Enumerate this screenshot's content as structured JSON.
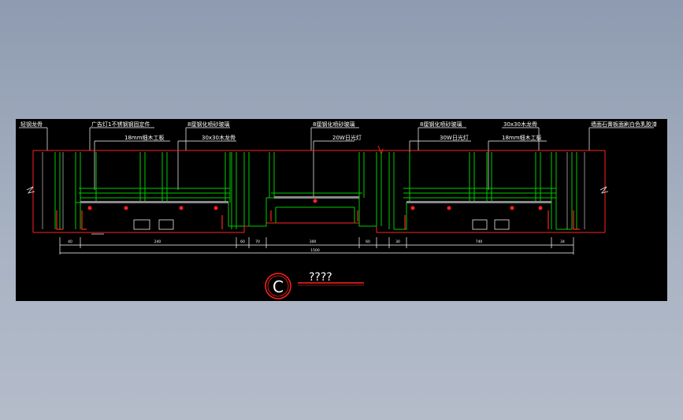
{
  "drawing": {
    "title_symbol": "C",
    "title_text": "????",
    "top_labels": [
      "轻钢龙骨",
      "广告灯1不锈钢钢固定件",
      "8厘钢化喷砂玻璃",
      "8厘钢化喷砂玻璃",
      "8厘钢化喷砂玻璃",
      "30x30木龙骨",
      "墙面石膏板面刷白色乳胶漆"
    ],
    "second_labels": [
      "18mm细木工板",
      "30x30木龙骨",
      "20W日光灯",
      "30W日光灯",
      "18mm细木工板"
    ],
    "dims": [
      "40",
      "240",
      "60",
      "70",
      "300",
      "60",
      "30",
      "740",
      "34"
    ],
    "total_dim": "1500"
  },
  "colors": {
    "line_green": "#00cc00",
    "line_red": "#ff2222",
    "line_white": "#e8e8e8",
    "line_gray": "#a0a0a0",
    "background": "#000000"
  }
}
